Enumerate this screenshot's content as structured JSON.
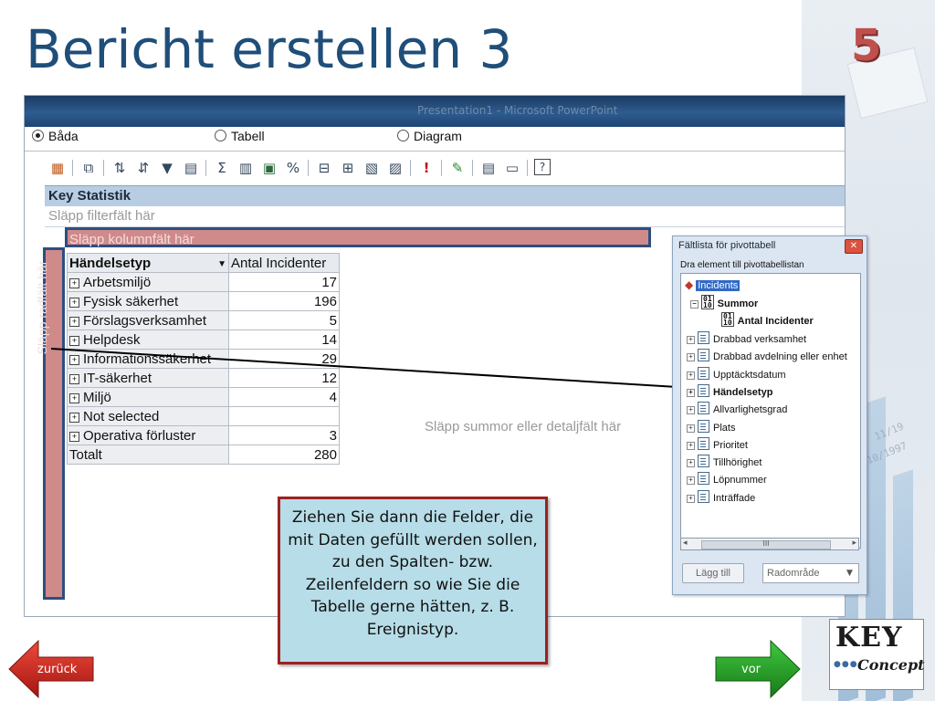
{
  "slide": {
    "title": "Bericht erstellen 3",
    "number": "5"
  },
  "window": {
    "title": "Presentation1 - Microsoft PowerPoint"
  },
  "view_options": {
    "both": "Båda",
    "table": "Tabell",
    "chart": "Diagram",
    "selected": "both"
  },
  "pivot": {
    "header": "Key Statistik",
    "filter_drop": "Släpp filterfält här",
    "column_drop": "Släpp kolumnfält här",
    "row_drop": "Släpp radfält här",
    "data_drop": "Släpp summor eller detaljfält här",
    "row_field": "Händelsetyp",
    "value_field": "Antal Incidenter",
    "rows": [
      {
        "label": "Arbetsmiljö",
        "value": "17"
      },
      {
        "label": "Fysisk säkerhet",
        "value": "196"
      },
      {
        "label": "Förslagsverksamhet",
        "value": "5"
      },
      {
        "label": "Helpdesk",
        "value": "14"
      },
      {
        "label": "Informationssäkerhet",
        "value": "29"
      },
      {
        "label": "IT-säkerhet",
        "value": "12"
      },
      {
        "label": "Miljö",
        "value": "4"
      },
      {
        "label": "Not selected",
        "value": ""
      },
      {
        "label": "Operativa förluster",
        "value": "3"
      }
    ],
    "total_label": "Totalt",
    "total_value": "280"
  },
  "field_list": {
    "title": "Fältlista för pivottabell",
    "subtitle": "Dra element till pivottabellistan",
    "root": "Incidents",
    "summary_group": "Summor",
    "summary_field": "Antal Incidenter",
    "fields": [
      "Drabbad verksamhet",
      "Drabbad avdelning eller enhet",
      "Upptäcktsdatum",
      "Händelsetyp",
      "Allvarlighetsgrad",
      "Plats",
      "Prioritet",
      "Tillhörighet",
      "Löpnummer",
      "Inträffade"
    ],
    "add_button": "Lägg till",
    "area_select": "Radområde"
  },
  "callout": {
    "text": "Ziehen Sie dann die Felder, die mit Daten gefüllt werden sollen, zu den Spalten- bzw. Zeilenfeldern so wie Sie die Tabelle gerne hätten, z. B. Ereignistyp."
  },
  "nav": {
    "back": "zurück",
    "next": "vor"
  },
  "logo": {
    "word1": "KEY",
    "word2": "Concept"
  },
  "colors": {
    "title": "#1f4e79",
    "slide_number": "#c0504d",
    "drop_zone": "#d08a8a",
    "drop_border": "#2b4f80",
    "callout_bg": "#b7dde8",
    "callout_border": "#9b2220",
    "nav_back": "#c8211c",
    "nav_next": "#2aa12a"
  },
  "icons": {
    "toolbar": [
      "pivot-format-icon",
      "copy-icon",
      "sort-ascending-icon",
      "sort-descending-icon",
      "autofilter-icon",
      "show-top-icon",
      "autosum-icon",
      "subtotal-icon",
      "calculated-total-icon",
      "percent-icon",
      "collapse-icon",
      "expand-icon",
      "hide-details-icon",
      "show-details-icon",
      "refresh-icon",
      "export-excel-icon",
      "field-list-icon",
      "properties-icon",
      "help-icon"
    ]
  }
}
